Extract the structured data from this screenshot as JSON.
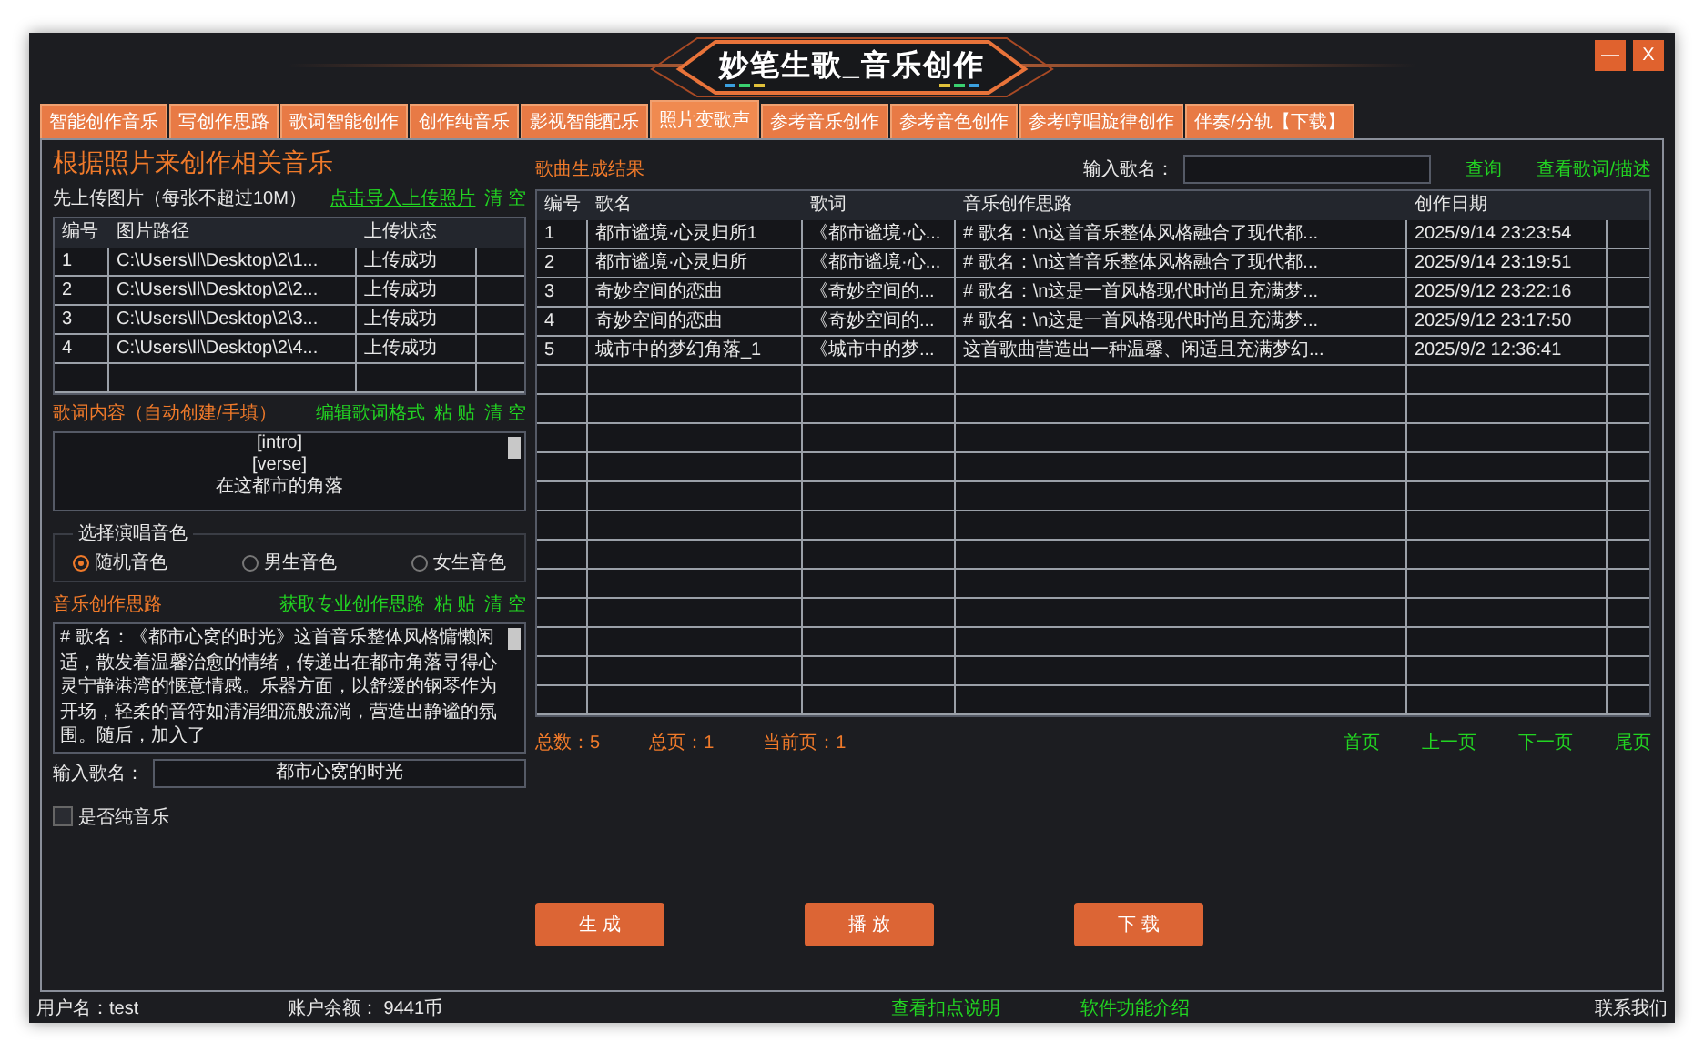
{
  "window": {
    "title": "妙笔生歌_音乐创作",
    "controls": [
      "—",
      "X"
    ]
  },
  "tabs": [
    {
      "label": "智能创作音乐",
      "selected": false
    },
    {
      "label": "写创作思路",
      "selected": false
    },
    {
      "label": "歌词智能创作",
      "selected": false
    },
    {
      "label": "创作纯音乐",
      "selected": false
    },
    {
      "label": "影视智能配乐",
      "selected": false
    },
    {
      "label": "照片变歌声",
      "selected": true
    },
    {
      "label": "参考音乐创作",
      "selected": false
    },
    {
      "label": "参考音色创作",
      "selected": false
    },
    {
      "label": "参考哼唱旋律创作",
      "selected": false
    },
    {
      "label": "伴奏/分轨【下载】",
      "selected": false
    }
  ],
  "left": {
    "heading": "根据照片来创作相关音乐",
    "upload": {
      "label": "先上传图片（每张不超过10M）",
      "link": "点击导入上传照片",
      "clear": "清 空"
    },
    "images": {
      "columns": [
        "编号",
        "图片路径",
        "上传状态"
      ],
      "rows": [
        [
          "1",
          "C:\\Users\\ll\\Desktop\\2\\1...",
          "上传成功"
        ],
        [
          "2",
          "C:\\Users\\ll\\Desktop\\2\\2...",
          "上传成功"
        ],
        [
          "3",
          "C:\\Users\\ll\\Desktop\\2\\3...",
          "上传成功"
        ],
        [
          "4",
          "C:\\Users\\ll\\Desktop\\2\\4...",
          "上传成功"
        ]
      ]
    },
    "lyrics": {
      "label": "歌词内容（自动创建/手填）",
      "actions": [
        "编辑歌词格式",
        "粘 贴",
        "清 空"
      ],
      "lines": [
        "[intro]",
        "[verse]",
        "在这都市的角落"
      ]
    },
    "voice": {
      "legend": "选择演唱音色",
      "options": [
        {
          "label": "随机音色",
          "selected": true
        },
        {
          "label": "男生音色",
          "selected": false
        },
        {
          "label": "女生音色",
          "selected": false
        }
      ]
    },
    "idea": {
      "label": "音乐创作思路",
      "actions": [
        "获取专业创作思路",
        "粘 贴",
        "清 空"
      ],
      "text": "# 歌名：《都市心窝的时光》这首音乐整体风格慵懒闲适，散发着温馨治愈的情绪，传递出在都市角落寻得心灵宁静港湾的惬意情感。乐器方面，以舒缓的钢琴作为开场，轻柔的音符如清涓细流般流淌，营造出静谧的氛围。随后，加入了"
    },
    "song_name": {
      "label": "输入歌名：",
      "value": "都市心窝的时光"
    },
    "pure_music": {
      "label": "是否纯音乐",
      "checked": false
    }
  },
  "results": {
    "title": "歌曲生成结果",
    "search": {
      "label": "输入歌名："
    },
    "actions": [
      "查询",
      "查看歌词/描述"
    ],
    "table": {
      "columns": [
        "编号",
        "歌名",
        "歌词",
        "音乐创作思路",
        "创作日期"
      ],
      "rows": [
        [
          "1",
          "都市谧境·心灵归所1",
          "《都市谧境·心...",
          "# 歌名：\\n这首音乐整体风格融合了现代都...",
          "2025/9/14 23:23:54"
        ],
        [
          "2",
          "都市谧境·心灵归所",
          "《都市谧境·心...",
          "# 歌名：\\n这首音乐整体风格融合了现代都...",
          "2025/9/14 23:19:51"
        ],
        [
          "3",
          "奇妙空间的恋曲",
          "《奇妙空间的...",
          "# 歌名：\\n这是一首风格现代时尚且充满梦...",
          "2025/9/12 23:22:16"
        ],
        [
          "4",
          "奇妙空间的恋曲",
          "《奇妙空间的...",
          "# 歌名：\\n这是一首风格现代时尚且充满梦...",
          "2025/9/12 23:17:50"
        ],
        [
          "5",
          "城市中的梦幻角落_1",
          "《城市中的梦...",
          "这首歌曲营造出一种温馨、闲适且充满梦幻...",
          "2025/9/2 12:36:41"
        ]
      ]
    },
    "pager": {
      "total": "总数：5",
      "pages": "总页：1",
      "current": "当前页：1",
      "links": [
        "首页",
        "上一页",
        "下一页",
        "尾页"
      ]
    }
  },
  "buttons": [
    "生 成",
    "播 放",
    "下 载"
  ],
  "status_bar": {
    "user": "用户名：test",
    "balance": "账户余额：  9441币",
    "links": [
      "查看扣点说明",
      "软件功能介绍"
    ],
    "contact": "联系我们"
  }
}
